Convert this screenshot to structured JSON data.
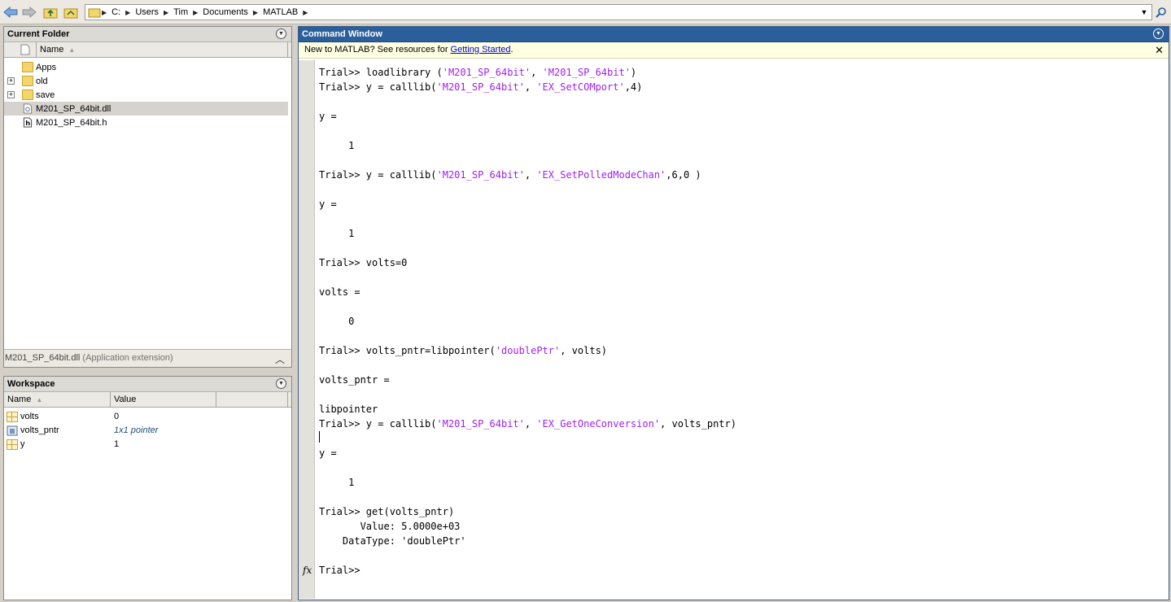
{
  "address_bar": {
    "crumbs": [
      "C:",
      "Users",
      "Tim",
      "Documents",
      "MATLAB"
    ]
  },
  "current_folder": {
    "title": "Current Folder",
    "column_name": "Name",
    "items": [
      {
        "name": "Apps",
        "type": "folder",
        "expandable": false
      },
      {
        "name": "old",
        "type": "folder",
        "expandable": true
      },
      {
        "name": "save",
        "type": "folder",
        "expandable": true
      },
      {
        "name": "M201_SP_64bit.dll",
        "type": "dll",
        "selected": true
      },
      {
        "name": "M201_SP_64bit.h",
        "type": "header"
      }
    ],
    "details": {
      "file": "M201_SP_64bit.dll",
      "description": "(Application extension)"
    }
  },
  "workspace": {
    "title": "Workspace",
    "columns": [
      "Name",
      "Value"
    ],
    "rows": [
      {
        "name": "volts",
        "value": "0",
        "icon": "matrix-icon"
      },
      {
        "name": "volts_pntr",
        "value": "1x1 pointer",
        "icon": "pointer-object-icon"
      },
      {
        "name": "y",
        "value": "1",
        "icon": "matrix-icon"
      }
    ]
  },
  "command_window": {
    "title": "Command Window",
    "banner": {
      "text": "New to MATLAB? See resources for ",
      "link": "Getting Started",
      "suffix": "."
    },
    "prompt": "Trial>> ",
    "lines": [
      [
        {
          "t": "Trial>> loadlibrary ("
        },
        {
          "t": "'M201_SP_64bit'",
          "s": true
        },
        {
          "t": ", "
        },
        {
          "t": "'M201_SP_64bit'",
          "s": true
        },
        {
          "t": ")"
        }
      ],
      [
        {
          "t": "Trial>> y = calllib("
        },
        {
          "t": "'M201_SP_64bit'",
          "s": true
        },
        {
          "t": ", "
        },
        {
          "t": "'EX_SetCOMport'",
          "s": true
        },
        {
          "t": ",4)"
        }
      ],
      [
        {
          "t": ""
        }
      ],
      [
        {
          "t": "y ="
        }
      ],
      [
        {
          "t": ""
        }
      ],
      [
        {
          "t": "     1"
        }
      ],
      [
        {
          "t": ""
        }
      ],
      [
        {
          "t": "Trial>> y = calllib("
        },
        {
          "t": "'M201_SP_64bit'",
          "s": true
        },
        {
          "t": ", "
        },
        {
          "t": "'EX_SetPolledModeChan'",
          "s": true
        },
        {
          "t": ",6,0 )"
        }
      ],
      [
        {
          "t": ""
        }
      ],
      [
        {
          "t": "y ="
        }
      ],
      [
        {
          "t": ""
        }
      ],
      [
        {
          "t": "     1"
        }
      ],
      [
        {
          "t": ""
        }
      ],
      [
        {
          "t": "Trial>> volts=0"
        }
      ],
      [
        {
          "t": ""
        }
      ],
      [
        {
          "t": "volts ="
        }
      ],
      [
        {
          "t": ""
        }
      ],
      [
        {
          "t": "     0"
        }
      ],
      [
        {
          "t": ""
        }
      ],
      [
        {
          "t": "Trial>> volts_pntr=libpointer("
        },
        {
          "t": "'doublePtr'",
          "s": true
        },
        {
          "t": ", volts)"
        }
      ],
      [
        {
          "t": ""
        }
      ],
      [
        {
          "t": "volts_pntr ="
        }
      ],
      [
        {
          "t": ""
        }
      ],
      [
        {
          "t": "libpointer"
        }
      ],
      [
        {
          "t": "Trial>> y = calllib("
        },
        {
          "t": "'M201_SP_64bit'",
          "s": true
        },
        {
          "t": ", "
        },
        {
          "t": "'EX_GetOneConversion'",
          "s": true
        },
        {
          "t": ", volts_pntr)"
        }
      ],
      [
        {
          "t": ""
        }
      ],
      [
        {
          "t": "y ="
        }
      ],
      [
        {
          "t": ""
        }
      ],
      [
        {
          "t": "     1"
        }
      ],
      [
        {
          "t": ""
        }
      ],
      [
        {
          "t": "Trial>> get(volts_pntr)"
        }
      ],
      [
        {
          "t": "       Value: 5.0000e+03"
        }
      ],
      [
        {
          "t": "    DataType: 'doublePtr'"
        }
      ],
      [
        {
          "t": ""
        }
      ],
      [
        {
          "t": "Trial>>"
        }
      ]
    ]
  }
}
